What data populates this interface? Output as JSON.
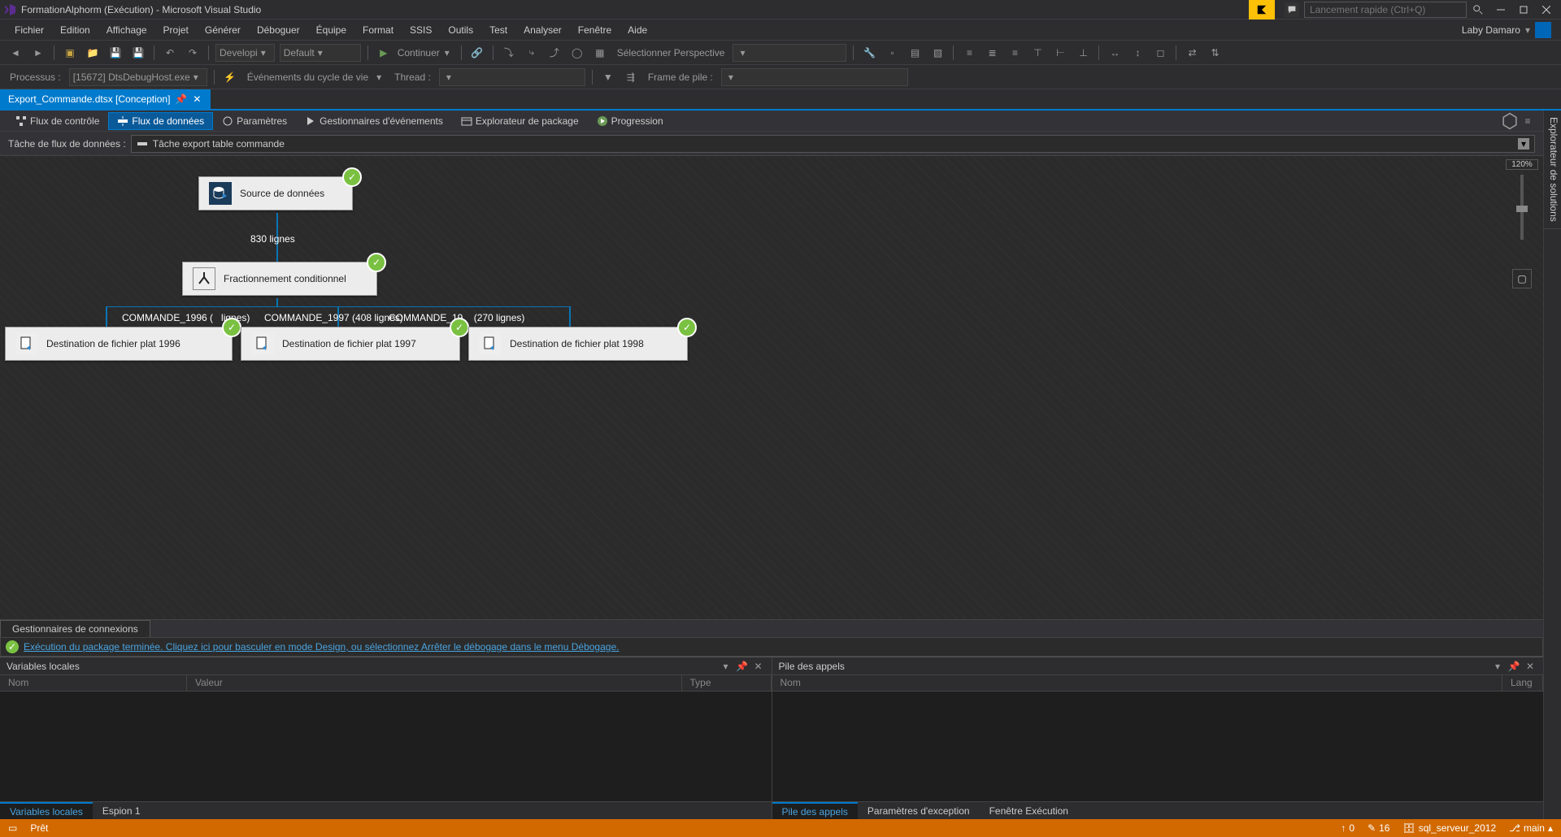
{
  "title": "FormationAlphorm (Exécution) - Microsoft Visual Studio",
  "quicklaunch_placeholder": "Lancement rapide (Ctrl+Q)",
  "menu": [
    "Fichier",
    "Edition",
    "Affichage",
    "Projet",
    "Générer",
    "Déboguer",
    "Équipe",
    "Format",
    "SSIS",
    "Outils",
    "Test",
    "Analyser",
    "Fenêtre",
    "Aide"
  ],
  "user": "Laby Damaro",
  "toolbar": {
    "config": "Developi",
    "platform": "Default",
    "run_label": "Continuer",
    "perspective_label": "Sélectionner Perspective"
  },
  "debugbar": {
    "process_label": "Processus :",
    "process_value": "[15672] DtsDebugHost.exe",
    "lifecycle_label": "Événements du cycle de vie",
    "thread_label": "Thread :",
    "stack_label": "Frame de pile :"
  },
  "doc_tab": "Export_Commande.dtsx [Conception]",
  "inner_tabs": {
    "control_flow": "Flux de contrôle",
    "data_flow": "Flux de données",
    "parameters": "Paramètres",
    "event_handlers": "Gestionnaires d'événements",
    "package_explorer": "Explorateur de package",
    "progress": "Progression"
  },
  "dataflow": {
    "task_label": "Tâche de flux de données :",
    "task_name": "Tâche export table commande",
    "nodes": {
      "source": "Source de données",
      "split": "Fractionnement conditionnel",
      "dest1996": "Destination de fichier plat 1996",
      "dest1997": "Destination de fichier plat 1997",
      "dest1998": "Destination de fichier plat 1998"
    },
    "paths": {
      "source_count": "830 lignes",
      "p1996": "COMMANDE_1996",
      "p1996_count": "lignes)",
      "p1997": "COMMANDE_1997 (408 lignes)",
      "p1998": "COMMANDE_19",
      "p1998_count": "(270 lignes)"
    },
    "zoom": "120%"
  },
  "connection_tab": "Gestionnaires de connexions",
  "exec_message": "Exécution du package terminée. Cliquez ici pour basculer en mode Design, ou sélectionnez Arrêter le débogage dans le menu Débogage.",
  "locals": {
    "title": "Variables locales",
    "cols": {
      "name": "Nom",
      "value": "Valeur",
      "type": "Type"
    },
    "tabs": {
      "locals": "Variables locales",
      "watch": "Espion 1"
    }
  },
  "callstack": {
    "title": "Pile des appels",
    "cols": {
      "name": "Nom",
      "lang": "Lang"
    },
    "tabs": {
      "callstack": "Pile des appels",
      "except": "Paramètres d'exception",
      "output": "Fenêtre Exécution"
    }
  },
  "rightdock": "Explorateur de solutions",
  "status": {
    "ready": "Prêt",
    "up_count": "0",
    "down_count": "16",
    "server": "sql_serveur_2012",
    "branch": "main"
  }
}
